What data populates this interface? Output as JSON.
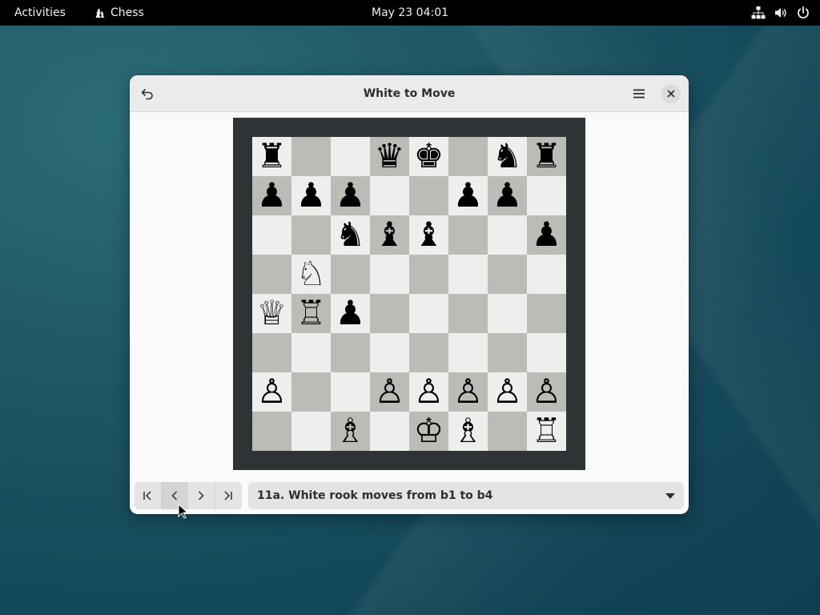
{
  "topbar": {
    "activities": "Activities",
    "app_name": "Chess",
    "clock": "May 23  04:01",
    "tray_icons": [
      "network-icon",
      "volume-icon",
      "power-icon"
    ]
  },
  "window": {
    "title": "White to Move",
    "undo_icon": "undo-icon",
    "menu_icon": "hamburger-menu-icon",
    "close_icon": "close-icon"
  },
  "board": {
    "light_color": "#eeeeec",
    "dark_color": "#babdb6",
    "frame_color": "#2e3436",
    "rows": [
      [
        "r",
        "",
        "",
        "q",
        "k",
        "",
        "n",
        "r"
      ],
      [
        "p",
        "p",
        "p",
        "",
        "",
        "p",
        "p",
        ""
      ],
      [
        "",
        "",
        "n",
        "b",
        "b",
        "",
        "",
        "p"
      ],
      [
        "",
        "N",
        "",
        "",
        "",
        "",
        "",
        ""
      ],
      [
        "Q",
        "R",
        "p",
        "",
        "",
        "",
        "",
        ""
      ],
      [
        "",
        "",
        "",
        "",
        "",
        "",
        "",
        ""
      ],
      [
        "P",
        "",
        "",
        "P",
        "P",
        "P",
        "P",
        "P"
      ],
      [
        "",
        "",
        "B",
        "",
        "K",
        "B",
        "",
        "R"
      ]
    ]
  },
  "history": {
    "nav_buttons": [
      "first-move",
      "previous-move",
      "next-move",
      "last-move"
    ],
    "current_move": "11a. White rook moves from b1 to b4"
  }
}
